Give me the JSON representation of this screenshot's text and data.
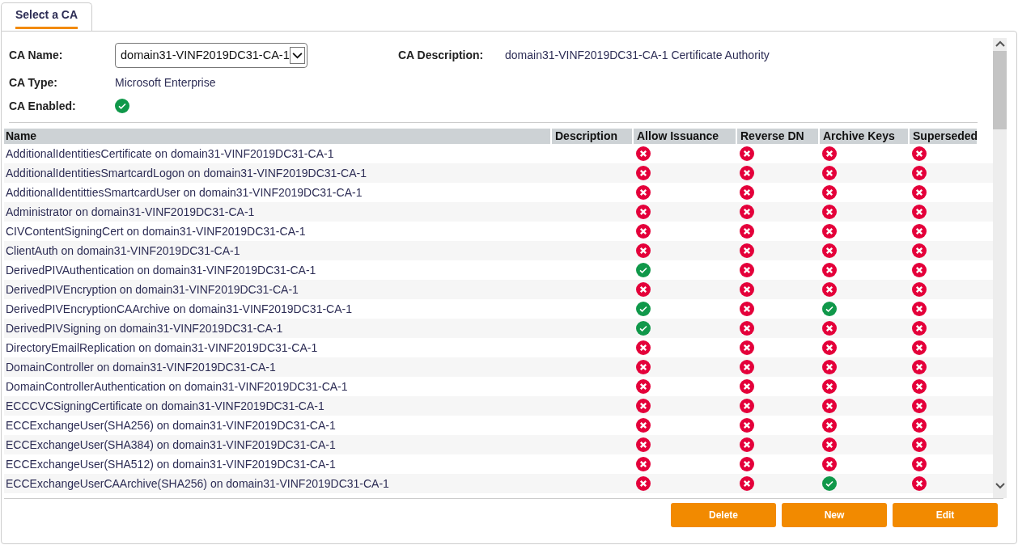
{
  "tabs": [
    {
      "label": "Select a CA",
      "selected": true
    }
  ],
  "form": {
    "ca_name_label": "CA Name:",
    "ca_name_value": "domain31-VINF2019DC31-CA-1",
    "ca_description_label": "CA Description:",
    "ca_description_value": "domain31-VINF2019DC31-CA-1 Certificate Authority",
    "ca_type_label": "CA Type:",
    "ca_type_value": "Microsoft Enterprise",
    "ca_enabled_label": "CA Enabled:",
    "ca_enabled": true
  },
  "table": {
    "columns": [
      "Name",
      "Description",
      "Allow Issuance",
      "Reverse DN",
      "Archive Keys",
      "Superseded"
    ],
    "rows": [
      {
        "name": "AdditionalIdentitiesCertificate on domain31-VINF2019DC31-CA-1",
        "allow_issuance": false,
        "reverse_dn": false,
        "archive_keys": false,
        "superseded": false
      },
      {
        "name": "AdditionalIdentitiesSmartcardLogon on domain31-VINF2019DC31-CA-1",
        "allow_issuance": false,
        "reverse_dn": false,
        "archive_keys": false,
        "superseded": false
      },
      {
        "name": "AdditionalIdentittiesSmartcardUser on domain31-VINF2019DC31-CA-1",
        "allow_issuance": false,
        "reverse_dn": false,
        "archive_keys": false,
        "superseded": false
      },
      {
        "name": "Administrator on domain31-VINF2019DC31-CA-1",
        "allow_issuance": false,
        "reverse_dn": false,
        "archive_keys": false,
        "superseded": false
      },
      {
        "name": "CIVContentSigningCert on domain31-VINF2019DC31-CA-1",
        "allow_issuance": false,
        "reverse_dn": false,
        "archive_keys": false,
        "superseded": false
      },
      {
        "name": "ClientAuth on domain31-VINF2019DC31-CA-1",
        "allow_issuance": false,
        "reverse_dn": false,
        "archive_keys": false,
        "superseded": false
      },
      {
        "name": "DerivedPIVAuthentication on domain31-VINF2019DC31-CA-1",
        "allow_issuance": true,
        "reverse_dn": false,
        "archive_keys": false,
        "superseded": false
      },
      {
        "name": "DerivedPIVEncryption on domain31-VINF2019DC31-CA-1",
        "allow_issuance": false,
        "reverse_dn": false,
        "archive_keys": false,
        "superseded": false
      },
      {
        "name": "DerivedPIVEncryptionCAArchive on domain31-VINF2019DC31-CA-1",
        "allow_issuance": true,
        "reverse_dn": false,
        "archive_keys": true,
        "superseded": false
      },
      {
        "name": "DerivedPIVSigning on domain31-VINF2019DC31-CA-1",
        "allow_issuance": true,
        "reverse_dn": false,
        "archive_keys": false,
        "superseded": false
      },
      {
        "name": "DirectoryEmailReplication on domain31-VINF2019DC31-CA-1",
        "allow_issuance": false,
        "reverse_dn": false,
        "archive_keys": false,
        "superseded": false
      },
      {
        "name": "DomainController on domain31-VINF2019DC31-CA-1",
        "allow_issuance": false,
        "reverse_dn": false,
        "archive_keys": false,
        "superseded": false
      },
      {
        "name": "DomainControllerAuthentication on domain31-VINF2019DC31-CA-1",
        "allow_issuance": false,
        "reverse_dn": false,
        "archive_keys": false,
        "superseded": false
      },
      {
        "name": "ECCCVCSigningCertificate on domain31-VINF2019DC31-CA-1",
        "allow_issuance": false,
        "reverse_dn": false,
        "archive_keys": false,
        "superseded": false
      },
      {
        "name": "ECCExchangeUser(SHA256) on domain31-VINF2019DC31-CA-1",
        "allow_issuance": false,
        "reverse_dn": false,
        "archive_keys": false,
        "superseded": false
      },
      {
        "name": "ECCExchangeUser(SHA384) on domain31-VINF2019DC31-CA-1",
        "allow_issuance": false,
        "reverse_dn": false,
        "archive_keys": false,
        "superseded": false
      },
      {
        "name": "ECCExchangeUser(SHA512) on domain31-VINF2019DC31-CA-1",
        "allow_issuance": false,
        "reverse_dn": false,
        "archive_keys": false,
        "superseded": false
      },
      {
        "name": "ECCExchangeUserCAArchive(SHA256) on domain31-VINF2019DC31-CA-1",
        "allow_issuance": false,
        "reverse_dn": false,
        "archive_keys": true,
        "superseded": false
      }
    ]
  },
  "buttons": [
    "Delete",
    "New",
    "Edit"
  ]
}
